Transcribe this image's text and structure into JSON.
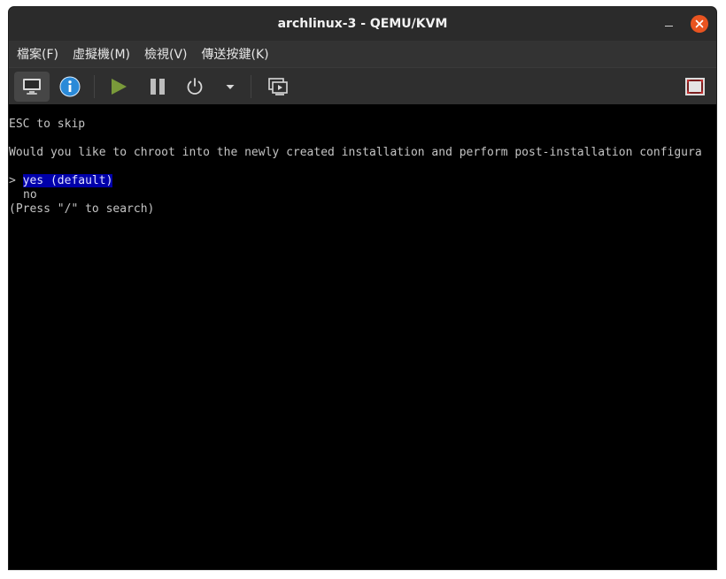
{
  "window": {
    "title": "archlinux-3 - QEMU/KVM"
  },
  "menu": {
    "file": "檔案(F)",
    "vm": "虛擬機(M)",
    "view": "檢視(V)",
    "sendkey": "傳送按鍵(K)"
  },
  "toolbar": {
    "icons": [
      "console-icon",
      "details-icon",
      "run-icon",
      "pause-icon",
      "power-icon",
      "dropdown-icon",
      "snapshot-icon",
      "fullscreen-icon"
    ]
  },
  "terminal": {
    "esc_hint": "ESC to skip",
    "question": "Would you like to chroot into the newly created installation and perform post-installation configura",
    "cursor": ">",
    "option_yes": "yes (default)",
    "option_no": "no",
    "search_hint": "(Press \"/\" to search)"
  },
  "colors": {
    "titlebar": "#2b2b2b",
    "menubar": "#333333",
    "toolbar": "#2f2f2f",
    "close_button": "#e95420",
    "selection": "#0000aa",
    "run_icon": "#7a9a3a",
    "info_icon": "#2a8ad8"
  }
}
